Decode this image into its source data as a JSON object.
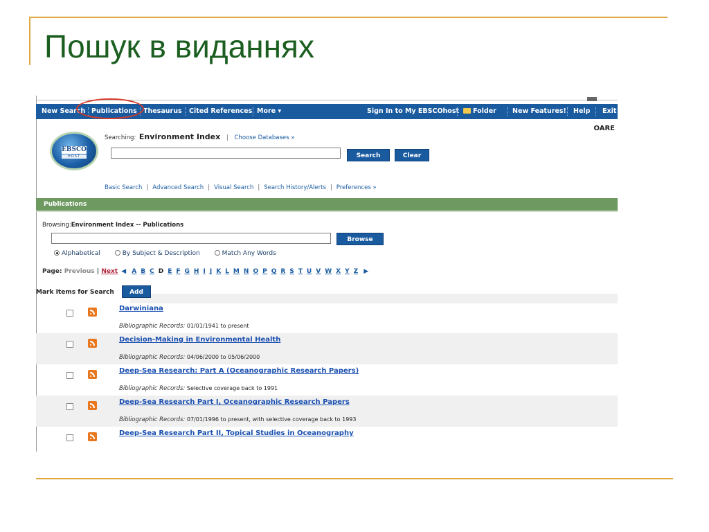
{
  "slide": {
    "title": "Пошук в виданнях"
  },
  "nav": {
    "items": [
      "New Search",
      "Publications",
      "Thesaurus",
      "Cited References",
      "More ▾"
    ],
    "right": [
      "Sign In to My EBSCOhost",
      "Folder",
      "New Features!",
      "Help",
      "Exit"
    ]
  },
  "header": {
    "logo_text": "EBSCO",
    "logo_sub": "HOST",
    "searching_label": "Searching:",
    "database": "Environment Index",
    "choose_db": "Choose Databases »",
    "institution": "OARE",
    "search_value": "",
    "search_button": "Search",
    "clear_button": "Clear",
    "links": [
      "Basic Search",
      "Advanced Search",
      "Visual Search",
      "Search History/Alerts",
      "Preferences »"
    ]
  },
  "publications": {
    "bar_title": "Publications",
    "browsing_label": "Browsing:",
    "browsing_value": "Environment Index -- Publications",
    "browse_value": "",
    "browse_button": "Browse",
    "radios": [
      {
        "label": "Alphabetical",
        "checked": true
      },
      {
        "label": "By Subject & Description",
        "checked": false
      },
      {
        "label": "Match Any Words",
        "checked": false
      }
    ],
    "page_label": "Page:",
    "previous": "Previous",
    "next": "Next",
    "letters": [
      "A",
      "B",
      "C",
      "D",
      "E",
      "F",
      "G",
      "H",
      "I",
      "J",
      "K",
      "L",
      "M",
      "N",
      "O",
      "P",
      "Q",
      "R",
      "S",
      "T",
      "U",
      "V",
      "W",
      "X",
      "Y",
      "Z"
    ],
    "current_letter": "D",
    "mark_label": "Mark Items for Search",
    "add_button": "Add"
  },
  "results": [
    {
      "title": "Darwiniana",
      "meta_label": "Bibliographic Records:",
      "meta_value": "01/01/1941 to present"
    },
    {
      "title": "Decision-Making in Environmental Health",
      "meta_label": "Bibliographic Records:",
      "meta_value": "04/06/2000 to 05/06/2000"
    },
    {
      "title": "Deep-Sea Research: Part A (Oceanographic Research Papers)",
      "meta_label": "Bibliographic Records:",
      "meta_value": "Selective coverage back to 1991"
    },
    {
      "title": "Deep-Sea Research Part I, Oceanographic Research Papers",
      "meta_label": "Bibliographic Records:",
      "meta_value": "07/01/1996 to present, with selective coverage back to 1993"
    },
    {
      "title": "Deep-Sea Research Part II, Topical Studies in Oceanography",
      "meta_label": "",
      "meta_value": ""
    }
  ],
  "colors": {
    "nav_bg": "#1A5BA0",
    "pub_bar": "#6E9A62",
    "title_green": "#1B5E20",
    "slide_accent": "#E0A840",
    "highlight_red": "#D63A2A"
  }
}
